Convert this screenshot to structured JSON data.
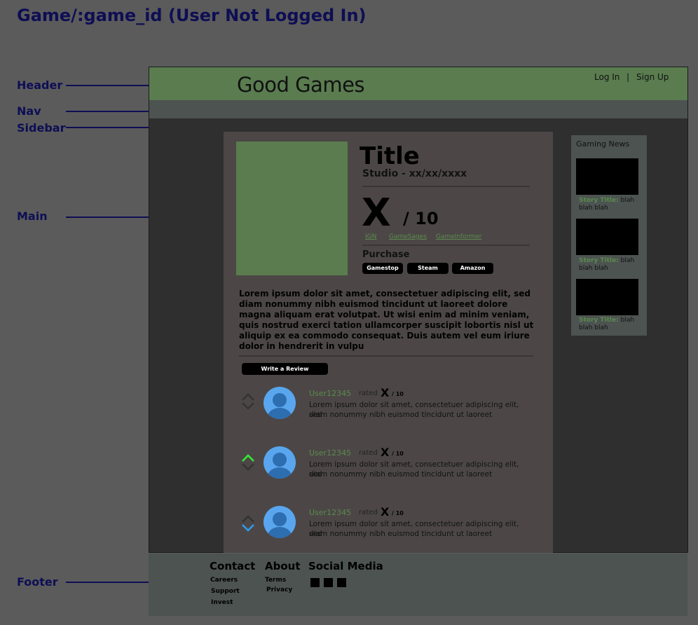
{
  "page_title": "Game/:game_id (User Not Logged In)",
  "annotations": {
    "header": "Header",
    "nav": "Nav",
    "sidebar": "Sidebar",
    "main": "Main",
    "footer": "Footer"
  },
  "header": {
    "brand": "Good Games",
    "login": "Log In",
    "separator": "|",
    "signup": "Sign Up"
  },
  "game": {
    "title": "Title",
    "studio": "Studio - xx/xx/xxxx",
    "score": "X",
    "score_out_of": "/ 10",
    "sources": [
      "IGN",
      "GameSages",
      "GameInformer"
    ],
    "purchase_label": "Purchase",
    "purchase_buttons": [
      "Gamestop",
      "Steam",
      "Amazon"
    ],
    "description": "Lorem ipsum dolor sit amet, consectetuer adipiscing elit, sed diam nonummy nibh euismod tincidunt ut laoreet dolore magna aliquam erat volutpat. Ut wisi enim ad minim veniam, quis nostrud exerci tation ullamcorper suscipit lobortis nisl ut aliquip ex ea commodo consequat. Duis autem vel eum iriure dolor in hendrerit in vulpu"
  },
  "reviews": {
    "write_button": "Write a Review",
    "items": [
      {
        "user": "User12345",
        "rated": "rated",
        "score": "X",
        "out_of": "/ 10",
        "line1": "Lorem ipsum dolor sit amet, consectetuer adipiscing elit, sed",
        "line2": "diam nonummy nibh euismod tincidunt ut laoreet",
        "vote": "none"
      },
      {
        "user": "User12345",
        "rated": "rated",
        "score": "X",
        "out_of": "/ 10",
        "line1": "Lorem ipsum dolor sit amet, consectetuer adipiscing elit, sed",
        "line2": "diam nonummy nibh euismod tincidunt ut laoreet",
        "vote": "up"
      },
      {
        "user": "User12345",
        "rated": "rated",
        "score": "X",
        "out_of": "/ 10",
        "line1": "Lorem ipsum dolor sit amet, consectetuer adipiscing elit, sed",
        "line2": "diam nonummy nibh euismod tincidunt ut laoreet",
        "vote": "down"
      }
    ]
  },
  "sidebar": {
    "title": "Gaming News",
    "stories": [
      {
        "label": "Story Title:",
        "text1": "blah",
        "text2": "blah blah"
      },
      {
        "label": "Story Title:",
        "text1": "blah",
        "text2": "blah blah"
      },
      {
        "label": "Story Title:",
        "text1": "blah",
        "text2": "blah blah"
      }
    ]
  },
  "footer": {
    "contact": {
      "heading": "Contact",
      "links": [
        "Careers",
        "Support",
        "Invest"
      ]
    },
    "about": {
      "heading": "About",
      "links": [
        "Terms",
        "Privacy"
      ]
    },
    "social": {
      "heading": "Social Media"
    }
  },
  "colors": {
    "up_vote": "#33ee33",
    "down_vote": "#3399ee",
    "neutral_vote": "#333333",
    "accent_green": "#5a7c4f",
    "annotation": "#0e0e55"
  }
}
